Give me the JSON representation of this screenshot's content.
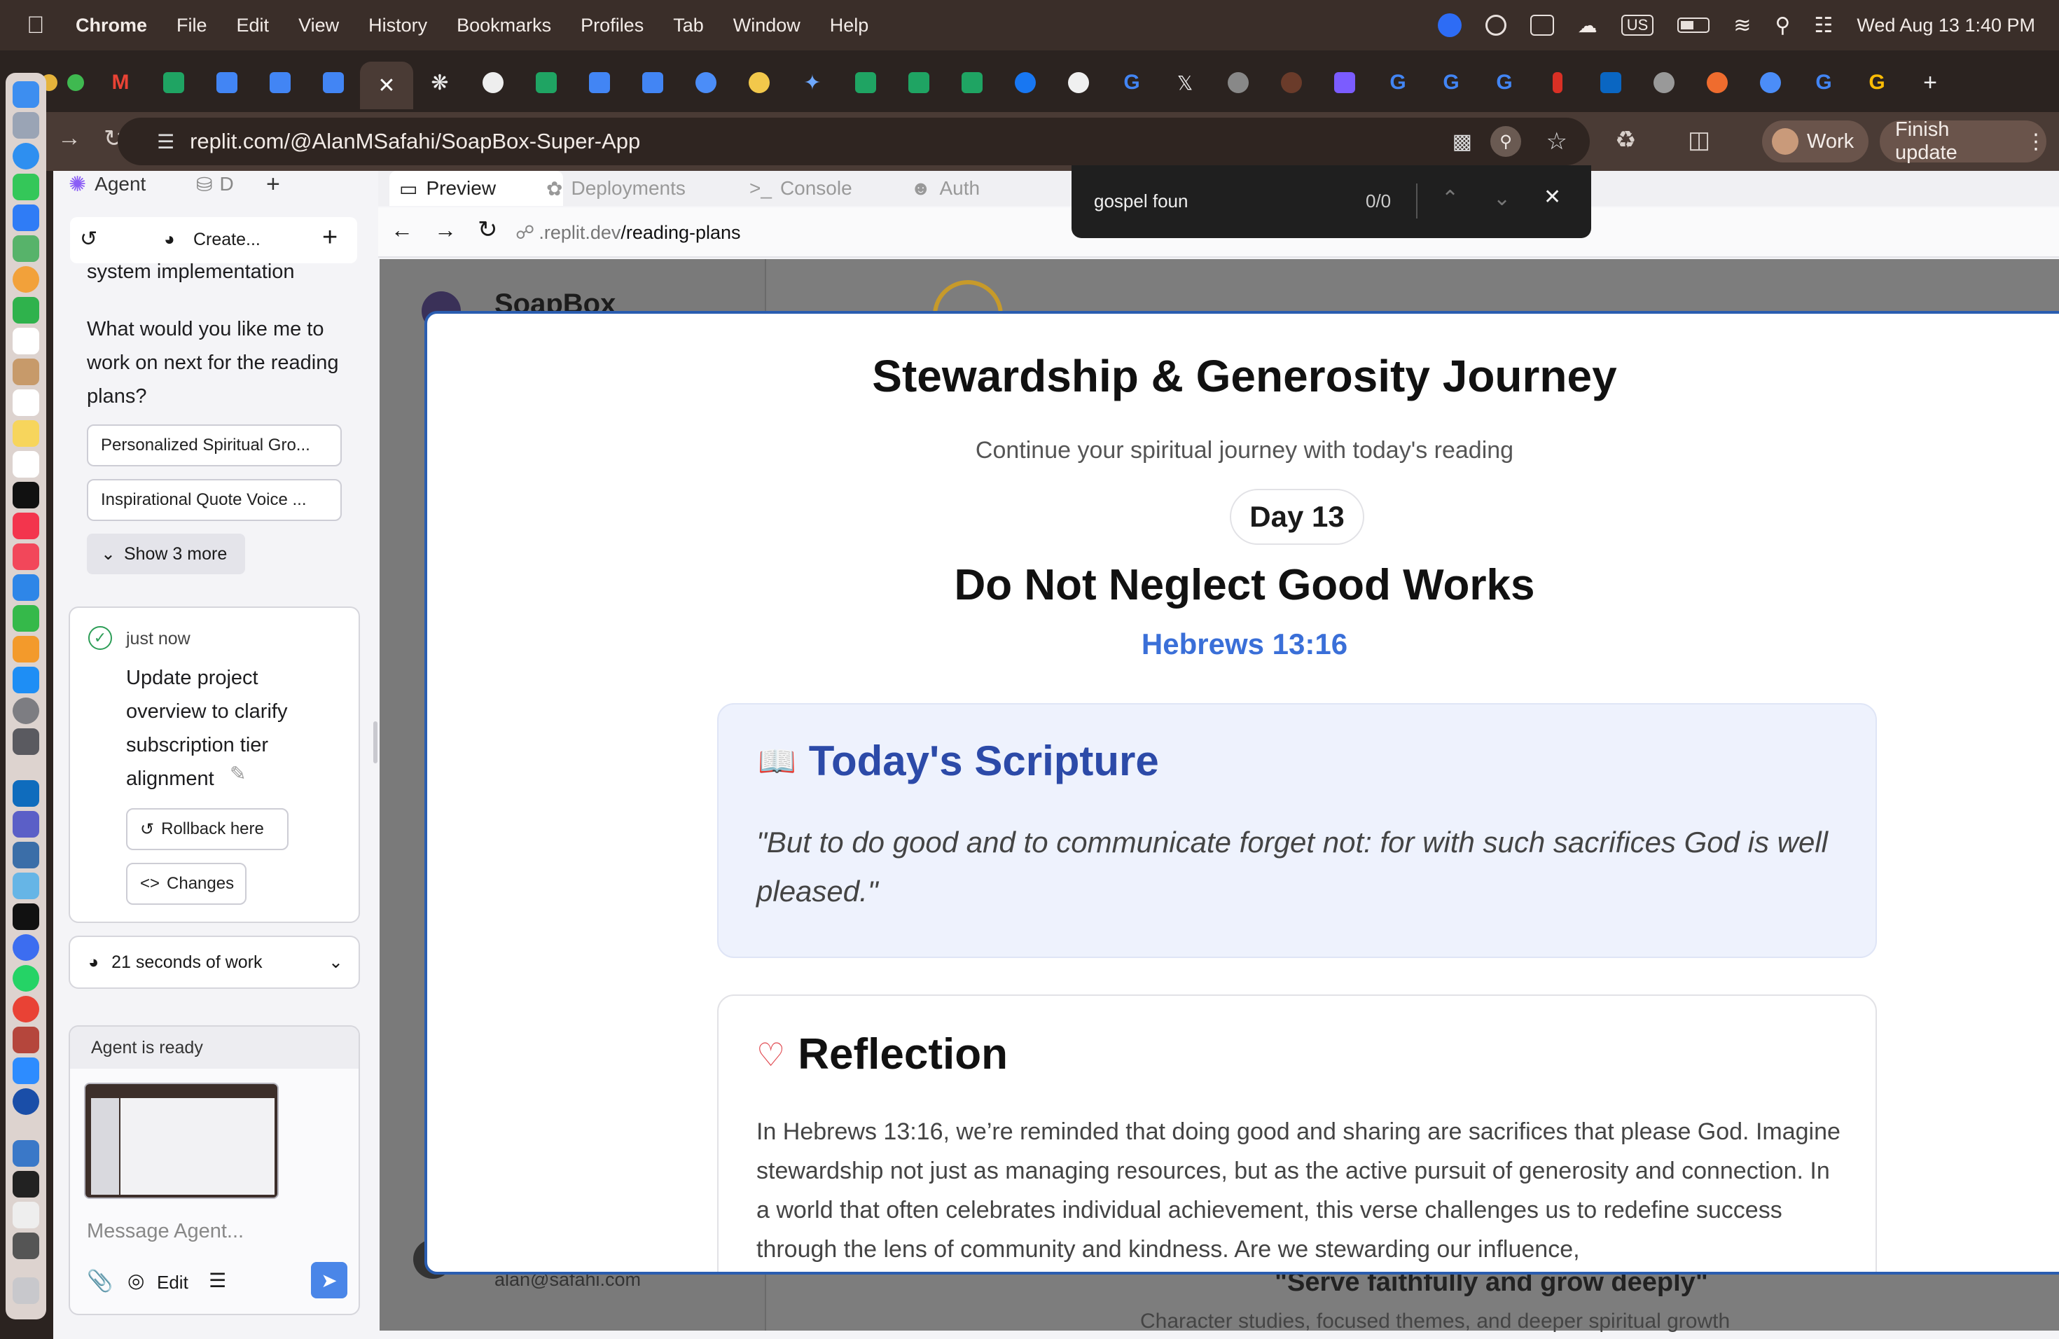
{
  "menubar": {
    "app": "Chrome",
    "items": [
      "File",
      "Edit",
      "View",
      "History",
      "Bookmarks",
      "Profiles",
      "Tab",
      "Window",
      "Help"
    ],
    "keyboard": "US",
    "datetime": "Wed Aug 13  1:40 PM"
  },
  "browser": {
    "url": "replit.com/@AlanMSafahi/SoapBox-Super-App",
    "profile": "Work",
    "update_label": "Finish update"
  },
  "find": {
    "query": "gospel foun",
    "count": "0/0"
  },
  "agent": {
    "tabs": [
      "Agent",
      "D"
    ],
    "toolbar_create": "Create...",
    "prev_text": "system implementation",
    "question": "What would you like me to work on next for the reading plans?",
    "suggestions": [
      "Personalized Spiritual Gro...",
      "Inspirational Quote Voice ..."
    ],
    "show_more": "Show 3 more",
    "checkpoint_time": "just now",
    "checkpoint_text": "Update project overview to clarify subscription tier alignment",
    "rollback": "Rollback here",
    "changes": "Changes",
    "work_summary": "21 seconds of work",
    "status": "Agent is ready",
    "input_placeholder": "Message Agent...",
    "edit_label": "Edit"
  },
  "preview": {
    "tabs": [
      "Preview",
      "Deployments",
      "Console",
      "Auth"
    ],
    "path_dim": ".replit.dev",
    "path": "/reading-plans",
    "bg_brand": "SoapBox",
    "bg_email": "alan@safahi.com"
  },
  "modal": {
    "plan_title": "Stewardship & Generosity Journey",
    "subtitle": "Continue your spiritual journey with today's reading",
    "day": "Day 13",
    "reading_title": "Do Not Neglect Good Works",
    "reference": "Hebrews 13:16",
    "scripture_heading": "Today's Scripture",
    "scripture_text": "\"But to do good and to communicate forget not: for with such sacrifices God is well pleased.\"",
    "reflection_heading": "Reflection",
    "reflection_text": "In Hebrews 13:16, we’re reminded that doing good and sharing are sacrifices that please God. Imagine stewardship not just as managing resources, but as the active pursuit of generosity and connection. In a world that often celebrates individual achievement, this verse challenges us to redefine success through the lens of community and kindness. Are we stewarding our influence,"
  },
  "bg_page": {
    "motto": "\"Serve faithfully and grow deeply\"",
    "motto_sub": "Character studies, focused themes, and deeper spiritual growth"
  },
  "colors": {
    "accent_blue": "#3a6fd8",
    "modal_border": "#2a5db0",
    "scripture_bg": "#eef2fd",
    "send_button": "#4a86e8"
  }
}
